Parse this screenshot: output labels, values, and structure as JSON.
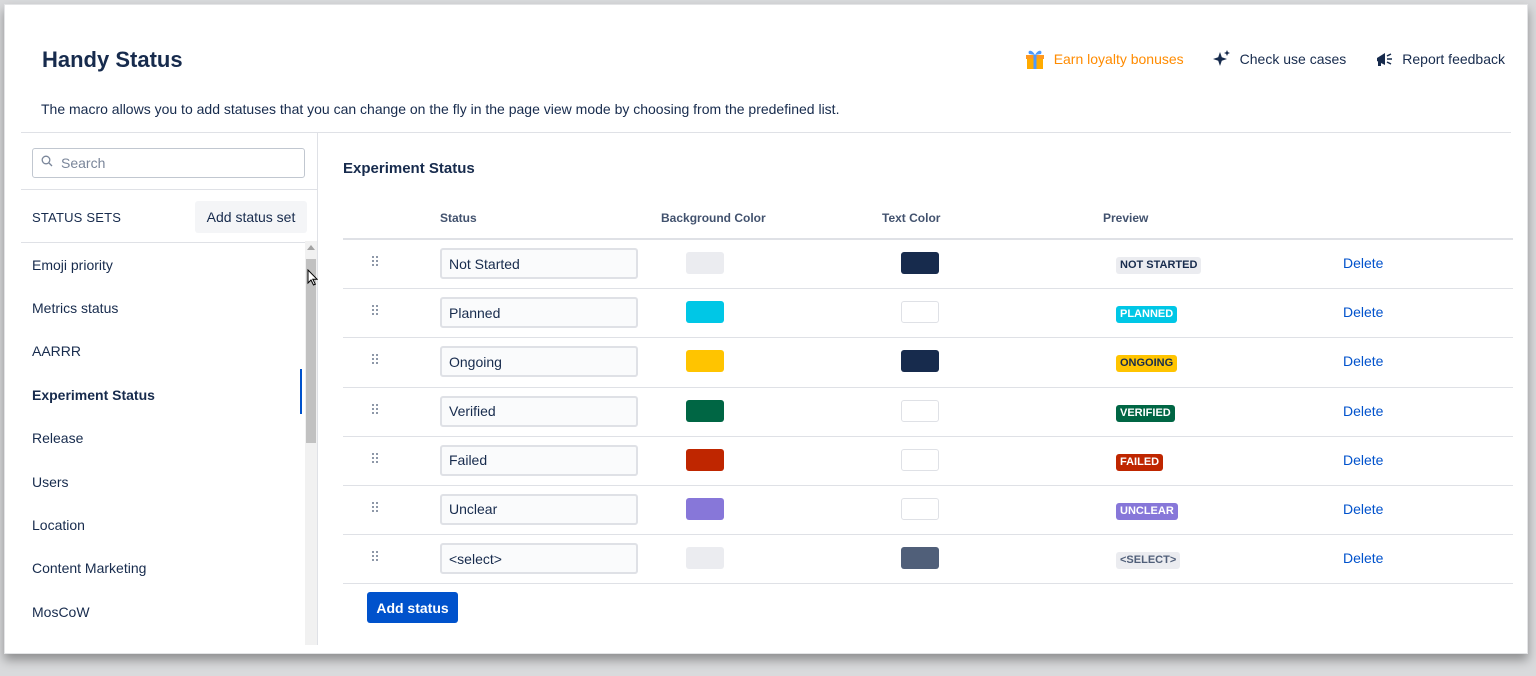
{
  "header": {
    "title": "Handy Status",
    "description": "The macro allows you to add statuses that you can change on the fly in the page view mode by choosing from the predefined list.",
    "actions": [
      {
        "label": "Earn loyalty bonuses",
        "icon": "gift-icon",
        "color": "#ff8b00"
      },
      {
        "label": "Check use cases",
        "icon": "sparkles-icon"
      },
      {
        "label": "Report feedback",
        "icon": "megaphone-icon"
      }
    ]
  },
  "sidebar": {
    "search_placeholder": "Search",
    "sets_label": "STATUS SETS",
    "add_set_label": "Add status set",
    "items": [
      {
        "label": "Emoji priority"
      },
      {
        "label": "Metrics status"
      },
      {
        "label": "AARRR"
      },
      {
        "label": "Experiment Status",
        "active": true
      },
      {
        "label": "Release"
      },
      {
        "label": "Users"
      },
      {
        "label": "Location"
      },
      {
        "label": "Content Marketing"
      },
      {
        "label": "MosCoW"
      }
    ]
  },
  "main": {
    "section_title": "Experiment Status",
    "columns": [
      "Status",
      "Background Color",
      "Text Color",
      "Preview"
    ],
    "delete_label": "Delete",
    "add_status_label": "Add status",
    "rows": [
      {
        "status": "Not Started",
        "preview": "NOT STARTED",
        "bg": "#ebecf0",
        "text": "#172b4d"
      },
      {
        "status": "Planned",
        "preview": "PLANNED",
        "bg": "#00c7e6",
        "text": "#ffffff"
      },
      {
        "status": "Ongoing",
        "preview": "ONGOING",
        "bg": "#ffc400",
        "text": "#172b4d"
      },
      {
        "status": "Verified",
        "preview": "VERIFIED",
        "bg": "#006644",
        "text": "#ffffff"
      },
      {
        "status": "Failed",
        "preview": "FAILED",
        "bg": "#bf2600",
        "text": "#ffffff"
      },
      {
        "status": "Unclear",
        "preview": "UNCLEAR",
        "bg": "#8777d9",
        "text": "#ffffff"
      },
      {
        "status": "<select>",
        "preview": "<SELECT>",
        "bg": "#ebecf0",
        "text": "#505f79"
      }
    ]
  }
}
